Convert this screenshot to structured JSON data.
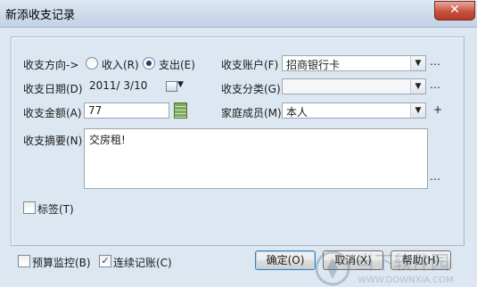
{
  "window": {
    "title": "新添收支记录",
    "close_glyph": "✕"
  },
  "form": {
    "direction_label": "收支方向->",
    "income_label": "收入(R)",
    "expense_label": "支出(E)",
    "direction_selected": "支出",
    "date_label": "收支日期(D)",
    "date_value": "2011/ 3/10",
    "amount_label": "收支金额(A)",
    "amount_value": "77",
    "summary_label": "收支摘要(N)",
    "summary_value": "交房租!",
    "account_label": "收支账户(F)",
    "account_value": "招商银行卡",
    "category_label": "收支分类(G)",
    "category_value": "",
    "member_label": "家庭成员(M)",
    "member_value": "本人",
    "tag_label": "标签(T)",
    "tag_checked": false,
    "more_glyph": "…",
    "plus_glyph": "+"
  },
  "footer": {
    "budget_label": "预算监控(B)",
    "budget_checked": false,
    "continuous_label": "连续记账(C)",
    "continuous_checked": true,
    "ok_label": "确定(O)",
    "cancel_label": "取消(X)",
    "help_label": "帮助(H)"
  },
  "watermark": {
    "text_cn": "当下软件园",
    "text_en": "WWW.DOWNXIA.COM"
  },
  "icons": {
    "close": "close-icon",
    "calendar": "calendar-icon",
    "calculator": "calculator-icon",
    "dropdown": "chevron-down-icon"
  }
}
